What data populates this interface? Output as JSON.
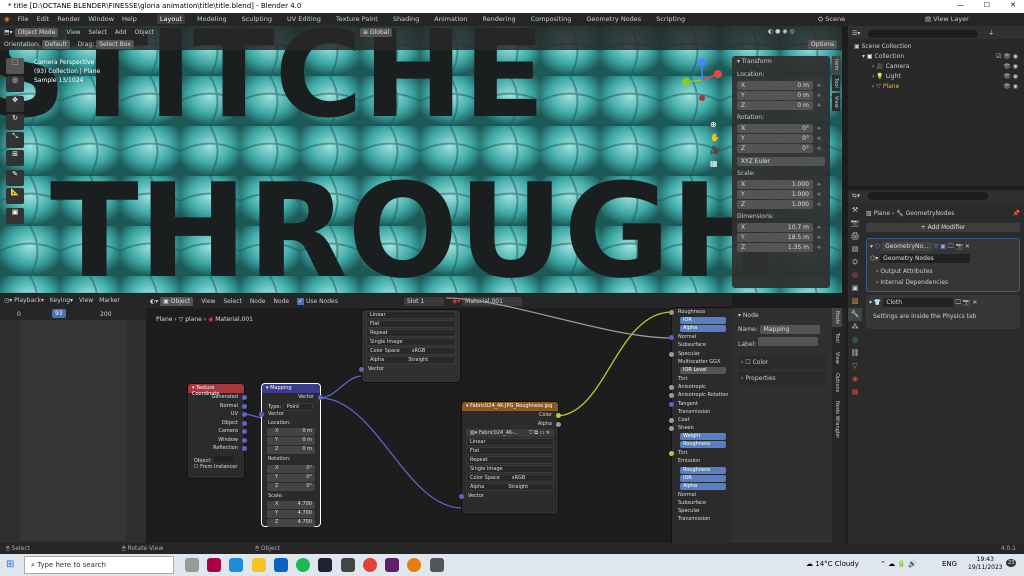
{
  "window": {
    "title": "* title [D:\\OCTANE BLENDER\\FINESSE\\gloria animation\\title\\title.blend] - Blender 4.0",
    "min": "—",
    "max": "☐",
    "close": "✕"
  },
  "menu": [
    "File",
    "Edit",
    "Render",
    "Window",
    "Help"
  ],
  "workspaces": [
    "Layout",
    "Modeling",
    "Sculpting",
    "UV Editing",
    "Texture Paint",
    "Shading",
    "Animation",
    "Rendering",
    "Compositing",
    "Geometry Nodes",
    "Scripting"
  ],
  "scene": "Scene",
  "view_layer": "View Layer",
  "header3d": {
    "mode": "Object Mode",
    "view": "View",
    "select": "Select",
    "add": "Add",
    "object": "Object",
    "transform": "Global",
    "options": "Options",
    "orientation_label": "Orientation:",
    "orientation": "Default",
    "drag_label": "Drag:",
    "drag": "Select Box"
  },
  "viewport_info": [
    "Camera Perspective",
    "(93) Collection | Plane",
    "Sample 13/1024"
  ],
  "transform": {
    "title": "Transform",
    "location": "Location:",
    "rotation": "Rotation:",
    "scale": "Scale:",
    "dimensions": "Dimensions:",
    "euler": "XYZ Euler",
    "loc": [
      [
        "X",
        "0 m"
      ],
      [
        "Y",
        "0 m"
      ],
      [
        "Z",
        "0 m"
      ]
    ],
    "rot": [
      [
        "X",
        "0°"
      ],
      [
        "Y",
        "0°"
      ],
      [
        "Z",
        "0°"
      ]
    ],
    "scl": [
      [
        "X",
        "1.000"
      ],
      [
        "Y",
        "1.000"
      ],
      [
        "Z",
        "1.000"
      ]
    ],
    "dim": [
      [
        "X",
        "10.7 m"
      ],
      [
        "Y",
        "18.5 m"
      ],
      [
        "Z",
        "1.35 m"
      ]
    ]
  },
  "side_tabs": [
    "Item",
    "Tool",
    "View"
  ],
  "outliner": {
    "root": "Scene Collection",
    "items": [
      "Collection",
      "Camera",
      "Light",
      "Plane"
    ]
  },
  "properties": {
    "breadcrumb": [
      "Plane",
      "GeometryNodes"
    ],
    "add_modifier": "Add Modifier",
    "mod1": "GeometryNo...",
    "mod1_group": "Geometry Nodes",
    "output_attrs": "Output Attributes",
    "internal_deps": "Internal Dependencies",
    "mod2": "Cloth",
    "cloth_note": "Settings are inside the Physics tab"
  },
  "timeline": {
    "playback": "Playback",
    "keying": "Keying",
    "view": "View",
    "marker": "Marker",
    "frames": [
      "0",
      "93",
      "200"
    ]
  },
  "node_header": {
    "object": "Object",
    "view": "View",
    "select": "Select",
    "add": "Node",
    "node": "Node",
    "use_nodes": "Use Nodes",
    "slot": "Slot 1",
    "material": "Material.001"
  },
  "node_breadcrumb": [
    "Plane",
    "plane",
    "Material.001"
  ],
  "nodes": {
    "texcoord": {
      "title": "Texture Coordinate",
      "outputs": [
        "Generated",
        "Normal",
        "UV",
        "Object",
        "Camera",
        "Window",
        "Reflection"
      ],
      "object": "Object:",
      "from_instancer": "From Instancer"
    },
    "mapping": {
      "title": "Mapping",
      "vector_out": "Vector",
      "type_label": "Type:",
      "type": "Point",
      "vector_in": "Vector",
      "location": "Location:",
      "rotation": "Rotation:",
      "scale": "Scale:",
      "loc": [
        [
          "X",
          "0 m"
        ],
        [
          "Y",
          "0 m"
        ],
        [
          "Z",
          "0 m"
        ]
      ],
      "rot": [
        [
          "X",
          "0°"
        ],
        [
          "Y",
          "0°"
        ],
        [
          "Z",
          "0°"
        ]
      ],
      "scl": [
        [
          "X",
          "4.700"
        ],
        [
          "Y",
          "4.700"
        ],
        [
          "Z",
          "4.700"
        ]
      ]
    },
    "image1": {
      "opts": [
        "Linear",
        "Flat",
        "Repeat",
        "Single Image"
      ],
      "colorspace_label": "Color Space",
      "colorspace": "sRGB",
      "alpha_label": "Alpha",
      "alpha": "Straight",
      "vector": "Vector"
    },
    "image2": {
      "title": "Fabric024_4K-JPG_Roughness.jpg",
      "file": "Fabric024_4K-...",
      "color": "Color",
      "alpha_out": "Alpha",
      "opts": [
        "Linear",
        "Flat",
        "Repeat",
        "Single Image"
      ],
      "colorspace_label": "Color Space",
      "colorspace": "sRGB",
      "alpha_label": "Alpha",
      "alpha": "Straight",
      "vector": "Vector"
    },
    "bsdf": [
      "Roughness",
      "IOR",
      "Alpha",
      "Normal",
      "Subsurface",
      "Specular",
      "Multiscatter GGX",
      "IOR Level",
      "Tint",
      "Anisotropic",
      "Anisotropic Rotation",
      "Tangent",
      "Transmission",
      "Coat",
      "Sheen",
      "Weight",
      "Roughness",
      "Tint",
      "Emission",
      "Roughness",
      "IOR",
      "Alpha",
      "Normal",
      "Subsurface",
      "Specular",
      "Transmission"
    ]
  },
  "node_panel": {
    "title": "Node",
    "name_label": "Name:",
    "name": "Mapping",
    "label_label": "Label:",
    "color": "Color",
    "properties": "Properties"
  },
  "node_side_tabs": [
    "Node",
    "Tool",
    "View",
    "Options",
    "Node Wrangler"
  ],
  "status": {
    "select": "Select",
    "rotate": "Rotate View",
    "object": "Object",
    "version": "4.0.1"
  },
  "taskbar": {
    "search": "Type here to search",
    "weather": "14°C  Cloudy",
    "lang": "ENG",
    "time": "19:43",
    "date": "19/11/2023",
    "notif": "23"
  }
}
